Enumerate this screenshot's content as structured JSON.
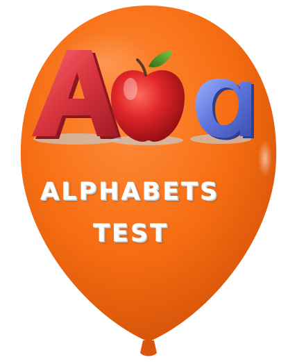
{
  "colors": {
    "balloon": "#f66d12",
    "balloon_dark": "#d4500a",
    "balloon_light": "#ff8a3a",
    "letter_A": "#d7333d",
    "letter_a": "#5d74d9",
    "apple": "#d81e20",
    "leaf": "#4f9a2a",
    "title_text": "#ffffff"
  },
  "icons": {
    "balloon": "balloon-icon",
    "letter_A": "letter-uppercase-a-icon",
    "apple": "apple-icon",
    "letter_a": "letter-lowercase-a-icon"
  },
  "title": {
    "line1": "ALPHABETS",
    "line2": "TEST"
  }
}
